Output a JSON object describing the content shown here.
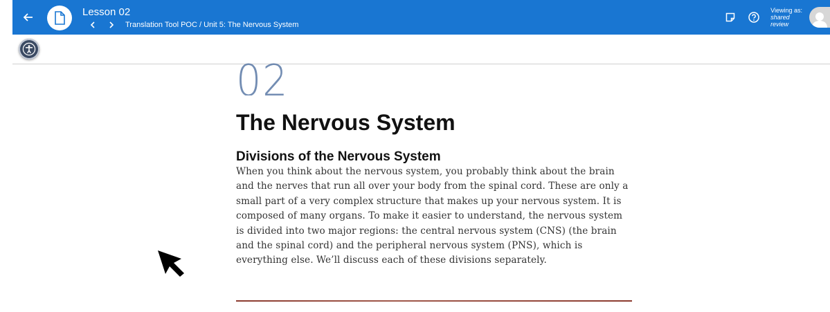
{
  "header": {
    "lesson_title": "Lesson 02",
    "breadcrumb": "Translation Tool POC / Unit 5: The Nervous System",
    "viewing_label": "Viewing as:",
    "viewing_mode_line1": "shared",
    "viewing_mode_line2": "review"
  },
  "icons": {
    "back": "arrow-left-icon",
    "document": "document-icon",
    "prev": "chevron-left-icon",
    "next": "chevron-right-icon",
    "notes": "sticky-note-icon",
    "help": "help-circle-icon",
    "accessibility": "accessibility-icon",
    "cursor": "mouse-pointer-icon"
  },
  "content": {
    "lesson_number": "02",
    "chapter_title": "The Nervous System",
    "section_heading": "Divisions of the Nervous System",
    "paragraph": "When you think about the nervous system, you probably think about the brain and the nerves that run all over your body from the spinal cord. These are only a small part of a very complex structure that makes up your nervous system. It is composed of many organs. To make it easier to understand, the nervous system is divided into two major regions: the central nervous system (CNS) (the brain and the spinal cord) and the peripheral nervous system (PNS), which is everything else. We’ll discuss each of these divisions separately."
  },
  "colors": {
    "appbar": "#1976d2",
    "lesson_number": "#5b7aa6",
    "accent_rule": "#8b3a2e"
  }
}
